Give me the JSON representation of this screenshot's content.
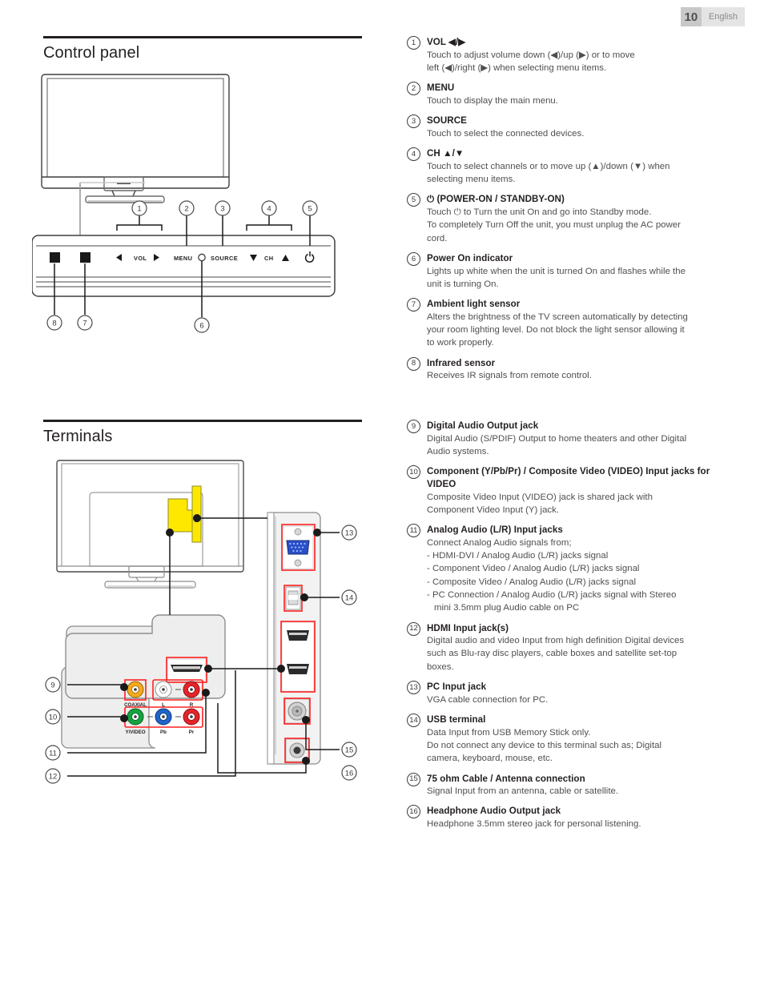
{
  "header": {
    "page_number": "10",
    "language": "English"
  },
  "sections": {
    "control_panel": {
      "title": "Control panel"
    },
    "terminals": {
      "title": "Terminals"
    }
  },
  "control_panel_items": [
    {
      "num": "1",
      "label": "VOL ◀/▶",
      "desc": [
        "Touch to adjust volume down (◀)/up (▶) or to move",
        "left (◀)/right (▶) when selecting menu items."
      ]
    },
    {
      "num": "2",
      "label": "MENU",
      "desc": [
        "Touch to display the main menu."
      ]
    },
    {
      "num": "3",
      "label": "SOURCE",
      "desc": [
        "Touch to select the connected devices."
      ]
    },
    {
      "num": "4",
      "label": "CH ▲/▼",
      "desc": [
        "Touch to select channels or to move up (▲)/down (▼) when",
        "selecting menu items."
      ]
    },
    {
      "num": "5",
      "label": "⏻ (POWER-ON / STANDBY-ON)",
      "desc": [
        "Touch ⏻ to Turn the unit On and go into Standby mode.",
        "To completely Turn Off the unit, you must unplug the AC power",
        "cord."
      ]
    },
    {
      "num": "6",
      "label": "Power On indicator",
      "desc": [
        "Lights up white when the unit is turned On and flashes while the",
        "unit is turning On."
      ]
    },
    {
      "num": "7",
      "label": "Ambient light sensor",
      "desc": [
        "Alters the brightness of the TV screen automatically by detecting",
        "your room lighting level. Do not block the light sensor allowing it",
        "to work properly."
      ]
    },
    {
      "num": "8",
      "label": "Infrared sensor",
      "desc": [
        "Receives IR signals from remote control."
      ]
    }
  ],
  "terminal_items": [
    {
      "num": "9",
      "label": "Digital Audio Output jack",
      "desc": [
        "Digital Audio (S/PDIF) Output to home theaters and other Digital",
        "Audio systems."
      ]
    },
    {
      "num": "10",
      "label": "Component (Y/Pb/Pr) / Composite Video (VIDEO) Input jacks for VIDEO",
      "desc": [
        "Composite Video Input (VIDEO) jack is shared jack with",
        "Component Video Input (Y) jack."
      ]
    },
    {
      "num": "11",
      "label": "Analog Audio (L/R) Input jacks",
      "desc": [
        "Connect Analog Audio signals from;",
        "- HDMI-DVI / Analog Audio (L/R) jacks signal",
        "- Component Video / Analog Audio (L/R) jacks signal",
        "- Composite Video / Analog Audio (L/R) jacks signal",
        "- PC Connection / Analog Audio (L/R) jacks signal with Stereo",
        "mini 3.5mm plug Audio cable on PC"
      ],
      "indent_last": true
    },
    {
      "num": "12",
      "label": "HDMI Input jack(s)",
      "desc": [
        "Digital audio and video Input from high definition Digital devices",
        "such as Blu-ray disc players, cable boxes and satellite set-top",
        "boxes."
      ]
    },
    {
      "num": "13",
      "label": "PC Input jack",
      "desc": [
        "VGA cable connection for PC."
      ]
    },
    {
      "num": "14",
      "label": "USB terminal",
      "desc": [
        "Data Input from USB Memory Stick only.",
        "Do not connect any device to this terminal such as; Digital",
        "camera, keyboard, mouse, etc."
      ]
    },
    {
      "num": "15",
      "label": "75 ohm Cable / Antenna connection",
      "desc": [
        "Signal Input from an antenna, cable or satellite."
      ]
    },
    {
      "num": "16",
      "label": "Headphone Audio Output jack",
      "desc": [
        "Headphone 3.5mm stereo jack for personal listening."
      ]
    }
  ],
  "control_panel_diagram": {
    "button_labels": [
      "VOL",
      "MENU",
      "SOURCE",
      "CH"
    ],
    "callouts": [
      "1",
      "2",
      "3",
      "4",
      "5",
      "6",
      "7",
      "8"
    ]
  },
  "terminals_diagram": {
    "jack_labels_row1": [
      "COAXIAL",
      "L",
      "R"
    ],
    "jack_labels_row2": [
      "Y/VIDEO",
      "Pb",
      "Pr"
    ],
    "callouts": [
      "9",
      "10",
      "11",
      "12",
      "13",
      "14",
      "15",
      "16"
    ],
    "colors": {
      "highlight": "#ffe800",
      "accent_outline": "#ff0000",
      "coaxial_jack": "#f7a81b",
      "left_audio_jack": "#ffffff",
      "right_audio_jack": "#e3242b",
      "y_video_jack": "#14a340",
      "pb_jack": "#1f64c8",
      "pr_jack": "#e3242b",
      "vga_jack": "#2b4fc8"
    }
  }
}
